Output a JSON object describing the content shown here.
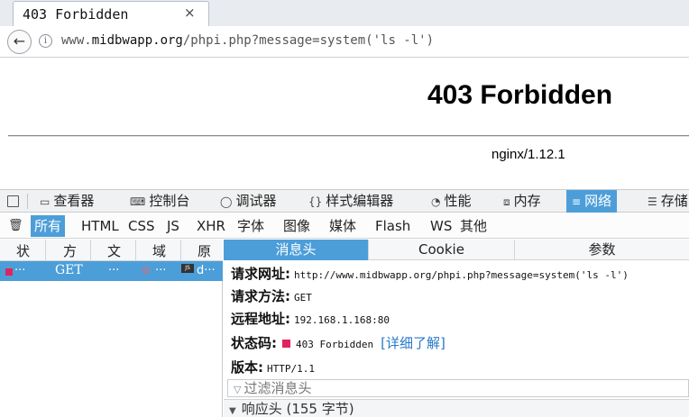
{
  "tab": {
    "title": "403 Forbidden",
    "close": "×"
  },
  "nav": {
    "back_icon": "←",
    "info_icon": "i",
    "url_prefix": "www.",
    "url_host": "midbwapp.org",
    "url_rest": "/phpi.php?message=system('ls -l')"
  },
  "page": {
    "heading": "403 Forbidden",
    "server": "nginx/1.12.1"
  },
  "devtools": {
    "tabs": [
      {
        "label": "查看器",
        "icon": "▭"
      },
      {
        "label": "控制台",
        "icon": "⌨"
      },
      {
        "label": "调试器",
        "icon": "◯"
      },
      {
        "label": "样式编辑器",
        "icon": "{}"
      },
      {
        "label": "性能",
        "icon": "◔"
      },
      {
        "label": "内存",
        "icon": "⧈"
      },
      {
        "label": "网络",
        "icon": "≡"
      },
      {
        "label": "存储",
        "icon": "☰"
      }
    ],
    "active_tab": "网络",
    "filters": [
      "所有",
      "HTML",
      "CSS",
      "JS",
      "XHR",
      "字体",
      "图像",
      "媒体",
      "Flash",
      "WS",
      "其他"
    ],
    "active_filter": "所有"
  },
  "request_list": {
    "columns": [
      "状",
      "方",
      "文",
      "域",
      "原"
    ],
    "row": {
      "status": "···",
      "method": "GET",
      "file": "···",
      "domain": "···",
      "cause": "d···",
      "type_badge": "JS"
    }
  },
  "details": {
    "tabs": [
      "消息头",
      "Cookie",
      "参数"
    ],
    "active_tab": "消息头",
    "fields": {
      "url_label": "请求网址:",
      "url_value": "http://www.midbwapp.org/phpi.php?message=system('ls -l')",
      "method_label": "请求方法:",
      "method_value": "GET",
      "remote_label": "远程地址:",
      "remote_value": "192.168.1.168:80",
      "status_label": "状态码:",
      "status_value": "403 Forbidden",
      "learn_more": "[详细了解]",
      "version_label": "版本:",
      "version_value": "HTTP/1.1"
    },
    "filter_placeholder": "过滤消息头",
    "response_headers": "响应头 (155 字节)"
  },
  "colors": {
    "accent": "#4c9ed9",
    "status_error": "#e0245e",
    "link": "#2878c8"
  }
}
